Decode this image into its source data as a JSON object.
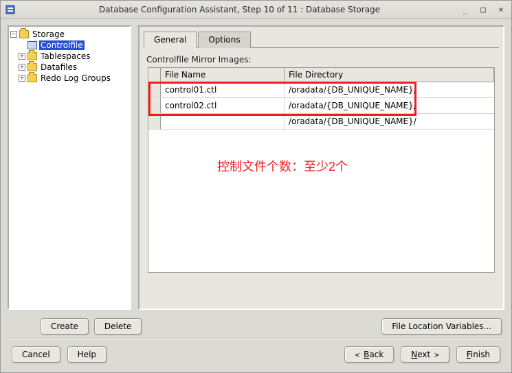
{
  "title": "Database Configuration Assistant, Step 10 of 11 : Database Storage",
  "tree": {
    "root": "Storage",
    "items": [
      "Controlfile",
      "Tablespaces",
      "Datafiles",
      "Redo Log Groups"
    ],
    "selected_index": 0
  },
  "buttons": {
    "create": "Create",
    "delete": "Delete",
    "file_loc": "File Location Variables...",
    "cancel": "Cancel",
    "help": "Help",
    "back_prefix": "B",
    "back_rest": "ack",
    "next_prefix": "N",
    "next_rest": "ext",
    "finish_prefix": "F",
    "finish_rest": "inish"
  },
  "tabs": {
    "general": "General",
    "options": "Options"
  },
  "section_label": "Controlfile Mirror Images:",
  "table": {
    "headers": {
      "fname": "File Name",
      "fdir": "File Directory"
    },
    "rows": [
      {
        "fname": "control01.ctl",
        "fdir": "/oradata/{DB_UNIQUE_NAME}/"
      },
      {
        "fname": "control02.ctl",
        "fdir": "/oradata/{DB_UNIQUE_NAME}/"
      },
      {
        "fname": "",
        "fdir": "/oradata/{DB_UNIQUE_NAME}/"
      }
    ]
  },
  "annotation": "控制文件个数：至少2个"
}
